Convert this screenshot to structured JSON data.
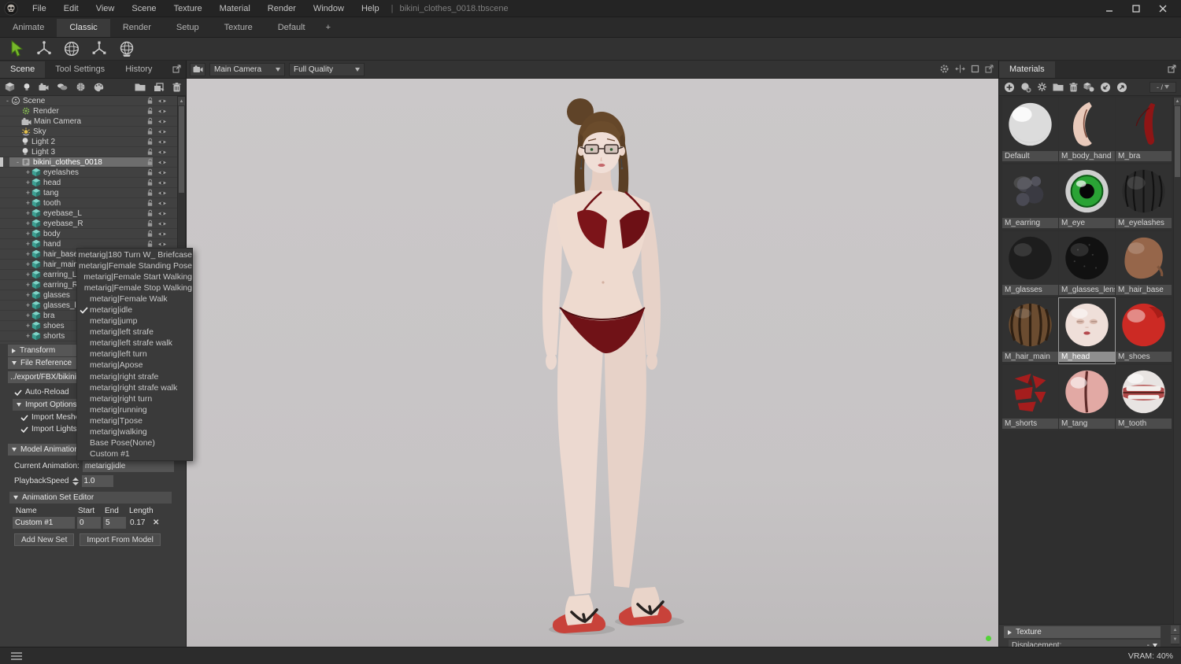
{
  "titlebar": {
    "menus": [
      "File",
      "Edit",
      "View",
      "Scene",
      "Texture",
      "Material",
      "Render",
      "Window",
      "Help"
    ],
    "separator": "|",
    "filename": "bikini_clothes_0018.tbscene"
  },
  "workspace_tabs": {
    "tabs": [
      "Animate",
      "Classic",
      "Render",
      "Setup",
      "Texture",
      "Default",
      "+"
    ],
    "active": "Classic"
  },
  "tool_toolbar": {
    "tools": [
      "select",
      "move",
      "rotate",
      "scale",
      "universal"
    ],
    "active": "select"
  },
  "left_panel": {
    "tabs": [
      "Scene",
      "Tool Settings",
      "History"
    ],
    "active_tab": "Scene",
    "scene_toolbar_icons": [
      "add-object",
      "add-light",
      "add-camera",
      "add-sky",
      "add-mesh",
      "add-material",
      "folder",
      "duplicate",
      "delete"
    ],
    "tree": [
      {
        "label": "Scene",
        "depth": 0,
        "icon": "scene",
        "expander": "-"
      },
      {
        "label": "Render",
        "depth": 1,
        "icon": "render"
      },
      {
        "label": "Main Camera",
        "depth": 1,
        "icon": "camera"
      },
      {
        "label": "Sky",
        "depth": 1,
        "icon": "sky"
      },
      {
        "label": "Light 2",
        "depth": 1,
        "icon": "light"
      },
      {
        "label": "Light 3",
        "depth": 1,
        "icon": "light"
      },
      {
        "label": "bikini_clothes_0018",
        "depth": 1,
        "icon": "model",
        "expander": "-",
        "selected": true
      },
      {
        "label": "eyelashes",
        "depth": 2,
        "icon": "mesh",
        "expander": "+"
      },
      {
        "label": "head",
        "depth": 2,
        "icon": "mesh",
        "expander": "+"
      },
      {
        "label": "tang",
        "depth": 2,
        "icon": "mesh",
        "expander": "+"
      },
      {
        "label": "tooth",
        "depth": 2,
        "icon": "mesh",
        "expander": "+"
      },
      {
        "label": "eyebase_L",
        "depth": 2,
        "icon": "mesh",
        "expander": "+"
      },
      {
        "label": "eyebase_R",
        "depth": 2,
        "icon": "mesh",
        "expander": "+"
      },
      {
        "label": "body",
        "depth": 2,
        "icon": "mesh",
        "expander": "+"
      },
      {
        "label": "hand",
        "depth": 2,
        "icon": "mesh",
        "expander": "+"
      },
      {
        "label": "hair_base",
        "depth": 2,
        "icon": "mesh",
        "expander": "+"
      },
      {
        "label": "hair_main",
        "depth": 2,
        "icon": "mesh",
        "expander": "+"
      },
      {
        "label": "earring_L",
        "depth": 2,
        "icon": "mesh",
        "expander": "+"
      },
      {
        "label": "earring_R",
        "depth": 2,
        "icon": "mesh",
        "expander": "+"
      },
      {
        "label": "glasses",
        "depth": 2,
        "icon": "mesh",
        "expander": "+"
      },
      {
        "label": "glasses_lens",
        "depth": 2,
        "icon": "mesh",
        "expander": "+"
      },
      {
        "label": "bra",
        "depth": 2,
        "icon": "mesh",
        "expander": "+"
      },
      {
        "label": "shoes",
        "depth": 2,
        "icon": "mesh",
        "expander": "+"
      },
      {
        "label": "shorts",
        "depth": 2,
        "icon": "mesh",
        "expander": "+"
      }
    ],
    "sections": {
      "transform": "Transform",
      "file_reference": "File Reference",
      "path_value": "../export/FBX/bikini",
      "auto_reload": "Auto-Reload",
      "import_options": "Import Options",
      "import_meshes": "Import Meshes",
      "import_lights": "Import Lights",
      "model_animation": "Model Animation"
    },
    "animation": {
      "current_label": "Current Animation:",
      "current_value": "metarig|idle",
      "speed_label": "PlaybackSpeed",
      "speed_value": "1.0",
      "editor_title": "Animation Set Editor",
      "columns": [
        "Name",
        "Start",
        "End",
        "Length"
      ],
      "row": {
        "name": "Custom #1",
        "start": "0",
        "end": "5",
        "length": "0.17",
        "delete_glyph": "✕"
      },
      "buttons": [
        "Add New Set",
        "Import From Model"
      ]
    }
  },
  "context_menu": {
    "items": [
      "metarig|180 Turn W_ Briefcase",
      "metarig|Female Standing Pose",
      "metarig|Female Start Walking",
      "metarig|Female Stop Walking",
      "metarig|Female Walk",
      "metarig|idle",
      "metarig|jump",
      "metarig|left strafe",
      "metarig|left strafe walk",
      "metarig|left turn",
      "metarig|Apose",
      "metarig|right strafe",
      "metarig|right strafe walk",
      "metarig|right turn",
      "metarig|running",
      "metarig|Tpose",
      "metarig|walking",
      "Base Pose(None)",
      "Custom #1"
    ],
    "checked": "metarig|idle"
  },
  "viewport": {
    "camera_select": "Main Camera",
    "quality_select": "Full Quality",
    "corner_icons": [
      "settings",
      "split",
      "maximize",
      "popout"
    ],
    "background_top": "#cbc8c9",
    "background_bottom": "#bdbabb"
  },
  "materials_panel": {
    "tab": "Materials",
    "toolbar_icons": [
      "new-material",
      "duplicate-material",
      "dissolve",
      "folder",
      "delete",
      "apply-to-mesh",
      "load",
      "save"
    ],
    "counter": "- /",
    "selected": "M_head",
    "items": [
      {
        "name": "Default",
        "style": "sphere-white"
      },
      {
        "name": "M_body_hand",
        "style": "skin-crescent"
      },
      {
        "name": "M_bra",
        "style": "red-crescent"
      },
      {
        "name": "M_earring",
        "style": "dark-blob"
      },
      {
        "name": "M_eye",
        "style": "eye-green"
      },
      {
        "name": "M_eyelashes",
        "style": "lash-sphere"
      },
      {
        "name": "M_glasses",
        "style": "near-black"
      },
      {
        "name": "M_glasses_lens",
        "style": "black-sparkle"
      },
      {
        "name": "M_hair_base",
        "style": "brown-blob"
      },
      {
        "name": "M_hair_main",
        "style": "hair-stripes"
      },
      {
        "name": "M_head",
        "style": "head-face"
      },
      {
        "name": "M_shoes",
        "style": "red-sphere"
      },
      {
        "name": "M_shorts",
        "style": "red-fragments"
      },
      {
        "name": "M_tang",
        "style": "pink-slit"
      },
      {
        "name": "M_tooth",
        "style": "tooth-sphere"
      }
    ],
    "texture_section": "Texture",
    "displacement_label": "Displacement:",
    "displacement_value": "-"
  },
  "statusbar": {
    "vram": "VRAM: 40%"
  },
  "colors": {
    "accent_green": "#76b82a",
    "selection_gray": "#6d6d6d",
    "bikini_red": "#701217"
  }
}
